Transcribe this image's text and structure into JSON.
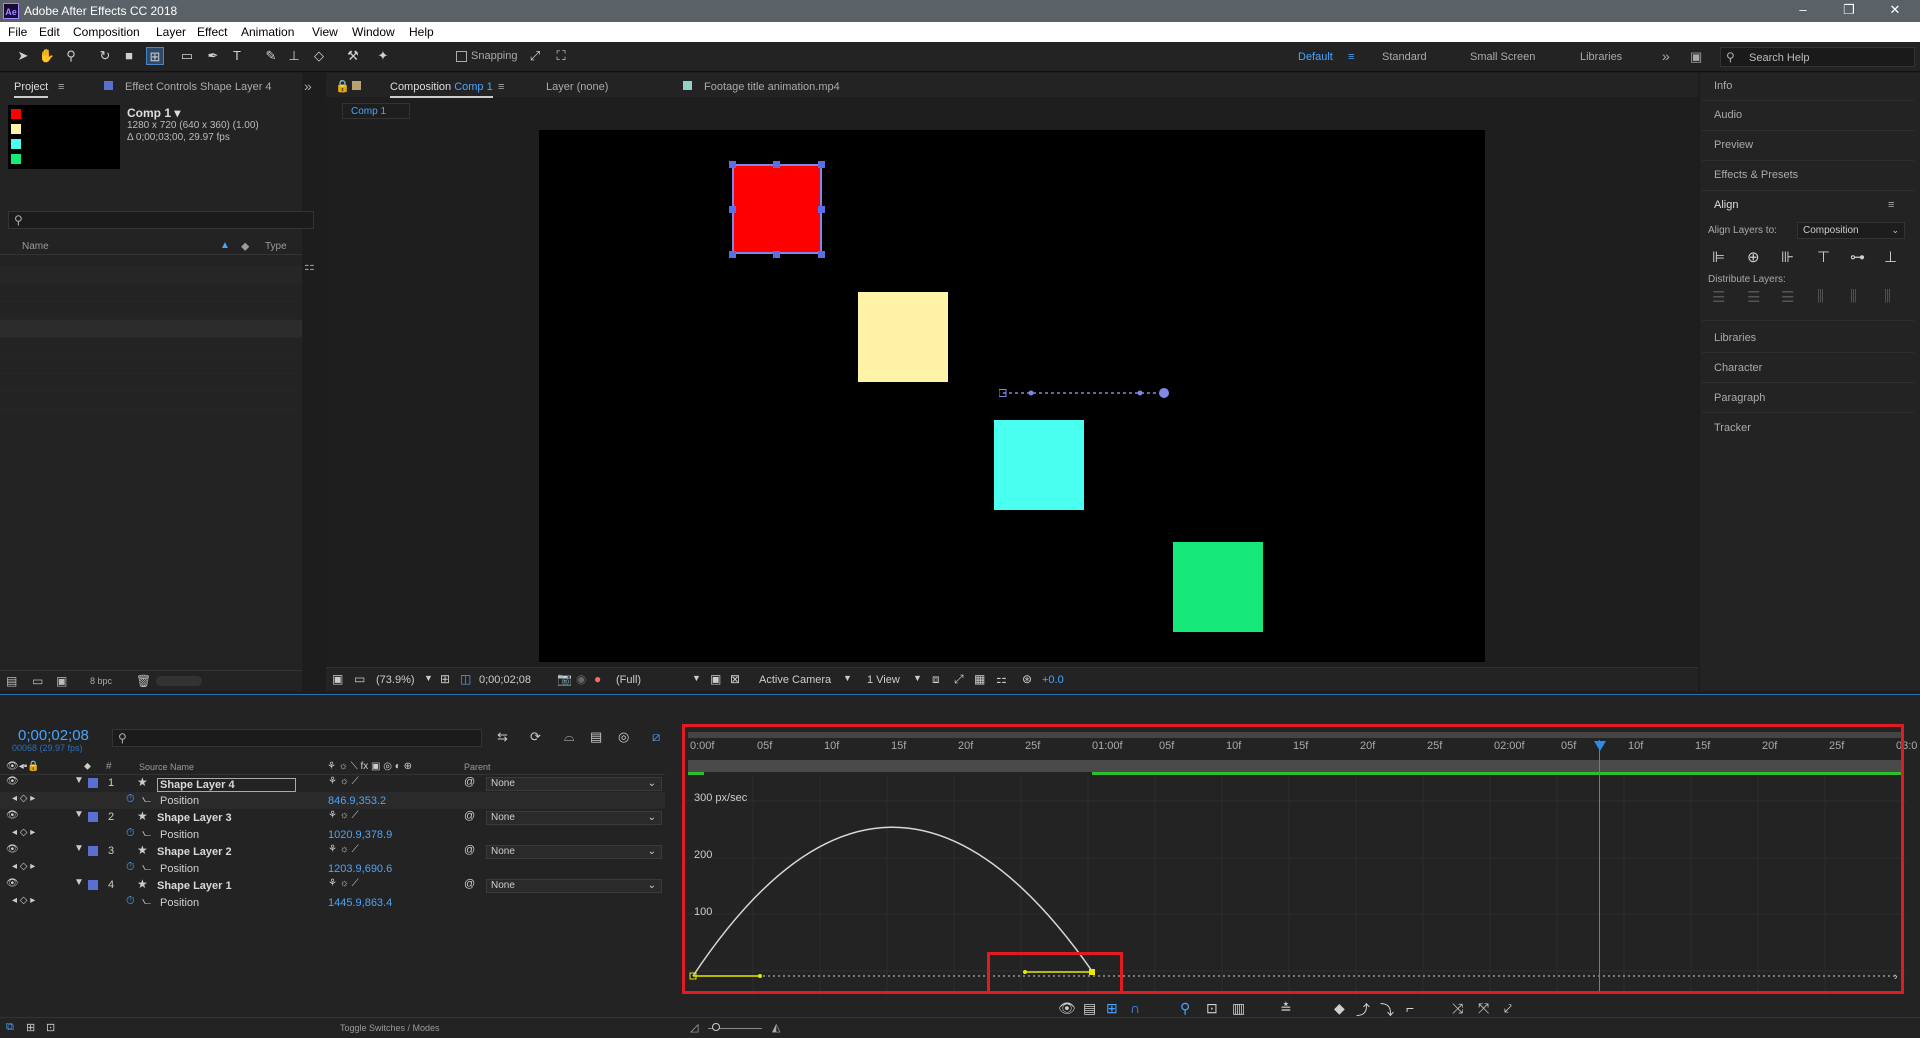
{
  "app": {
    "title": "Adobe After Effects CC 2018",
    "icon_text": "Ae",
    "window_controls": [
      "–",
      "❐",
      "✕"
    ]
  },
  "menu": [
    "File",
    "Edit",
    "Composition",
    "Layer",
    "Effect",
    "Animation",
    "View",
    "Window",
    "Help"
  ],
  "toolbar": {
    "snapping_label": "Snapping",
    "workspaces": [
      "Default",
      "Standard",
      "Small Screen",
      "Libraries"
    ],
    "active_workspace": "Default",
    "search_placeholder": "Search Help"
  },
  "project_panel": {
    "tab_project": "Project",
    "tab_effect_controls": "Effect Controls Shape Layer 4",
    "comp_name": "Comp 1 ▾",
    "comp_res": "1280 x 720  (640 x 360) (1.00)",
    "comp_dur": "Δ 0;00;03;00, 29.97 fps",
    "col_name": "Name",
    "col_type": "Type",
    "bpc": "8 bpc",
    "swatches": [
      "#ff0000",
      "#fff3a8",
      "#48fff0",
      "#17e87a"
    ]
  },
  "composition_panel": {
    "tab_comp_prefix": "Composition",
    "tab_comp_name": "Comp 1",
    "tab_layer": "Layer (none)",
    "tab_footage": "Footage title animation.mp4",
    "breadcrumb": "Comp 1",
    "zoom": "(73.9%)",
    "timecode": "0;00;02;08",
    "resolution": "(Full)",
    "camera": "Active Camera",
    "views": "1 View",
    "exposure": "+0.0"
  },
  "right_panel": {
    "items_top": [
      "Info",
      "Audio",
      "Preview",
      "Effects & Presets"
    ],
    "align_title": "Align",
    "align_to_label": "Align Layers to:",
    "align_to_value": "Composition",
    "distribute_label": "Distribute Layers:",
    "items_bottom": [
      "Libraries",
      "Character",
      "Paragraph",
      "Tracker"
    ]
  },
  "timeline": {
    "timecode": "0;00;02;08",
    "frames": "00068 (29.97 fps)",
    "col_source": "Source Name",
    "col_parent": "Parent",
    "toggle_label": "Toggle Switches / Modes",
    "layers": [
      {
        "num": "1",
        "name": "Shape Layer 4",
        "parent": "None",
        "prop": "Position",
        "value": "846.9,353.2",
        "color": "#5a70d0"
      },
      {
        "num": "2",
        "name": "Shape Layer 3",
        "parent": "None",
        "prop": "Position",
        "value": "1020.9,378.9",
        "color": "#5a70d0"
      },
      {
        "num": "3",
        "name": "Shape Layer 2",
        "parent": "None",
        "prop": "Position",
        "value": "1203.9,690.6",
        "color": "#5a70d0"
      },
      {
        "num": "4",
        "name": "Shape Layer 1",
        "parent": "None",
        "prop": "Position",
        "value": "1445.9,863.4",
        "color": "#5a70d0"
      }
    ],
    "ruler": [
      "0:00f",
      "05f",
      "10f",
      "15f",
      "20f",
      "25f",
      "01:00f",
      "05f",
      "10f",
      "15f",
      "20f",
      "25f",
      "02:00f",
      "05f",
      "10f",
      "15f",
      "20f",
      "25f",
      "03:0"
    ],
    "graph_labels": [
      "300 px/sec",
      "200",
      "100"
    ]
  },
  "colors": {
    "accent_blue": "#2d8ceb",
    "highlight_red": "#e01b22",
    "graph_yellow": "#e8e800"
  }
}
